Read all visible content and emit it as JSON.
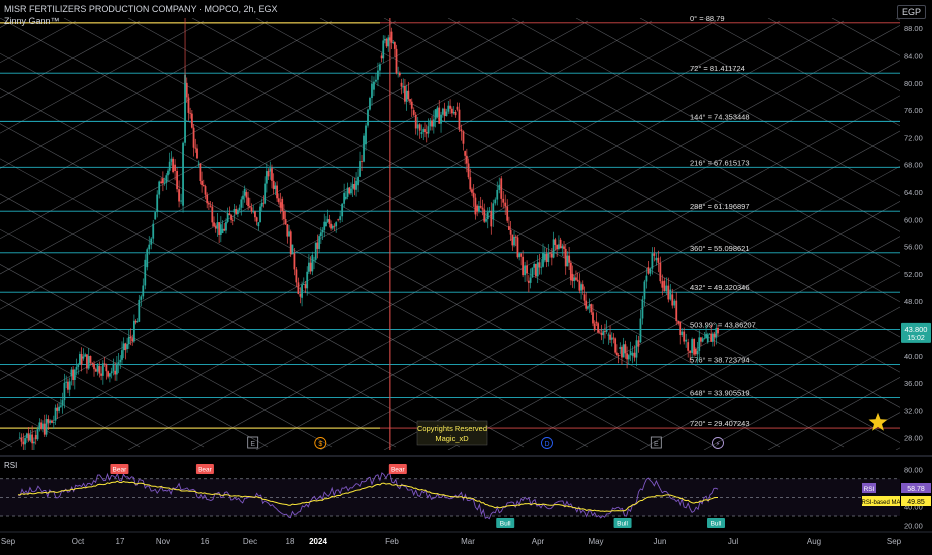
{
  "header": {
    "symbol_line": "MISR FERTILIZERS PRODUCTION COMPANY · MOPCO, 2h, EGX",
    "indicator_name": "Zinny Gann™",
    "currency": "EGP"
  },
  "watermark": {
    "line1": "Copyrights Reserved",
    "line2": "Magic_xD"
  },
  "colors": {
    "up": "#26a69a",
    "down": "#ef5350",
    "gann_level": "#26c6da",
    "gann_top": "#ffee58",
    "gann_red": "#ef5350",
    "diagonal": "#9598a1",
    "rsi": "#7e57c2",
    "rsi_ma": "#ffeb3b",
    "star": "#f5c518"
  },
  "chart_data": [
    {
      "type": "candlestick",
      "price_axis": {
        "ticks": [
          88,
          84,
          80,
          76,
          72,
          68,
          64,
          60,
          56,
          52,
          48,
          44,
          40,
          36,
          32,
          28
        ],
        "range": [
          26.2,
          89.5
        ]
      },
      "time_axis": {
        "labels": [
          "Sep",
          "Oct",
          "17",
          "Nov",
          "16",
          "Dec",
          "18",
          "2024",
          "Feb",
          "Mar",
          "Apr",
          "May",
          "Jun",
          "Jul",
          "Aug",
          "Sep"
        ]
      },
      "current_price": {
        "value": "43.800",
        "countdown": "15:02"
      },
      "gann_levels": [
        {
          "label": "0° = 88.79",
          "value": 88.79
        },
        {
          "label": "72° = 81.411724",
          "value": 81.411724
        },
        {
          "label": "144° = 74.353448",
          "value": 74.353448
        },
        {
          "label": "216° = 67.615173",
          "value": 67.615173
        },
        {
          "label": "288° = 61.196897",
          "value": 61.196897
        },
        {
          "label": "360° = 55.098621",
          "value": 55.098621
        },
        {
          "label": "432° = 49.320346",
          "value": 49.320346
        },
        {
          "label": "503.99° = 43.86207",
          "value": 43.86207
        },
        {
          "label": "576° = 38.723794",
          "value": 38.723794
        },
        {
          "label": "648° = 33.905519",
          "value": 33.905519
        },
        {
          "label": "720° = 29.407243",
          "value": 29.407243
        }
      ],
      "price_path": [
        [
          0,
          28.0
        ],
        [
          0.4,
          28.4
        ],
        [
          0.9,
          30.5
        ],
        [
          1.3,
          37
        ],
        [
          1.6,
          39.6
        ],
        [
          2.0,
          38.5
        ],
        [
          2.4,
          37.8
        ],
        [
          2.7,
          41
        ],
        [
          3.0,
          45
        ],
        [
          3.2,
          53
        ],
        [
          3.4,
          60
        ],
        [
          3.6,
          66
        ],
        [
          3.9,
          68
        ],
        [
          4.1,
          62
        ],
        [
          4.2,
          80
        ],
        [
          4.5,
          68
        ],
        [
          4.8,
          62
        ],
        [
          5.1,
          58
        ],
        [
          5.4,
          61
        ],
        [
          5.7,
          64
        ],
        [
          6.0,
          59
        ],
        [
          6.3,
          67
        ],
        [
          6.6,
          63
        ],
        [
          6.9,
          55
        ],
        [
          7.1,
          48.5
        ],
        [
          7.4,
          54
        ],
        [
          7.7,
          59
        ],
        [
          8.0,
          60
        ],
        [
          8.2,
          63
        ],
        [
          8.5,
          65
        ],
        [
          8.7,
          71
        ],
        [
          8.9,
          79
        ],
        [
          9.1,
          84
        ],
        [
          9.35,
          87.5
        ],
        [
          9.6,
          80
        ],
        [
          9.9,
          76
        ],
        [
          10.1,
          72.5
        ],
        [
          10.5,
          75
        ],
        [
          11.0,
          76.5
        ],
        [
          11.2,
          70
        ],
        [
          11.5,
          62
        ],
        [
          11.9,
          60
        ],
        [
          12.1,
          66
        ],
        [
          12.3,
          59
        ],
        [
          12.6,
          55
        ],
        [
          12.8,
          51
        ],
        [
          13.2,
          54
        ],
        [
          13.6,
          57
        ],
        [
          13.9,
          52
        ],
        [
          14.2,
          49
        ],
        [
          14.5,
          45
        ],
        [
          14.8,
          43
        ],
        [
          15.1,
          41
        ],
        [
          15.4,
          40
        ],
        [
          15.6,
          42
        ],
        [
          15.8,
          53
        ],
        [
          16.0,
          54
        ],
        [
          16.2,
          51
        ],
        [
          16.4,
          49
        ],
        [
          16.6,
          45
        ],
        [
          16.8,
          42
        ],
        [
          17.0,
          41
        ],
        [
          17.3,
          42
        ],
        [
          17.6,
          43.8
        ]
      ],
      "events": [
        {
          "kind": "earnings",
          "label": "E",
          "at": 5.9
        },
        {
          "kind": "dividend",
          "label": "$",
          "at": 7.6
        },
        {
          "kind": "dividend",
          "label": "D",
          "at": 13.3
        },
        {
          "kind": "earnings",
          "label": "E",
          "at": 16.05
        },
        {
          "kind": "split",
          "label": "⚡",
          "at": 17.6
        }
      ],
      "star_marker": {
        "price": 30.2
      }
    },
    {
      "type": "line",
      "name": "RSI",
      "axis": {
        "ticks": [
          80,
          60,
          40,
          20
        ],
        "range": [
          15,
          88
        ]
      },
      "bands": {
        "upper": 70,
        "middle": 50,
        "lower": 30
      },
      "series": [
        {
          "name": "RSI",
          "value": "58.78",
          "points": [
            [
              0,
              54
            ],
            [
              0.5,
              58
            ],
            [
              1.0,
              52
            ],
            [
              1.5,
              62
            ],
            [
              2.0,
              70
            ],
            [
              2.5,
              73
            ],
            [
              3.0,
              66
            ],
            [
              3.4,
              60
            ],
            [
              3.8,
              55
            ],
            [
              4.1,
              62
            ],
            [
              4.4,
              55
            ],
            [
              4.8,
              49
            ],
            [
              5.2,
              53
            ],
            [
              5.6,
              46
            ],
            [
              6.0,
              50
            ],
            [
              6.4,
              44
            ],
            [
              6.8,
              31
            ],
            [
              7.2,
              42
            ],
            [
              7.6,
              51
            ],
            [
              8.0,
              57
            ],
            [
              8.4,
              60
            ],
            [
              8.8,
              67
            ],
            [
              9.3,
              74
            ],
            [
              9.7,
              60
            ],
            [
              10.1,
              55
            ],
            [
              10.6,
              50
            ],
            [
              11.0,
              54
            ],
            [
              11.4,
              47
            ],
            [
              11.8,
              30
            ],
            [
              12.3,
              42
            ],
            [
              12.8,
              47
            ],
            [
              13.2,
              40
            ],
            [
              13.7,
              45
            ],
            [
              14.2,
              35
            ],
            [
              14.6,
              30
            ],
            [
              15.0,
              36
            ],
            [
              15.4,
              33
            ],
            [
              15.8,
              72
            ],
            [
              16.2,
              58
            ],
            [
              16.6,
              47
            ],
            [
              17.0,
              36
            ],
            [
              17.3,
              48
            ],
            [
              17.6,
              58.78
            ]
          ]
        },
        {
          "name": "RSI-based MA",
          "value": "49.85",
          "points": [
            [
              0,
              53
            ],
            [
              1.0,
              56
            ],
            [
              2.0,
              63
            ],
            [
              2.5,
              67
            ],
            [
              3.2,
              64
            ],
            [
              4.0,
              58
            ],
            [
              5.0,
              53
            ],
            [
              6.0,
              50
            ],
            [
              6.8,
              42
            ],
            [
              7.6,
              47
            ],
            [
              8.4,
              56
            ],
            [
              9.2,
              65
            ],
            [
              9.8,
              62
            ],
            [
              10.6,
              53
            ],
            [
              11.4,
              49
            ],
            [
              12.0,
              39
            ],
            [
              12.8,
              43
            ],
            [
              13.6,
              42
            ],
            [
              14.4,
              36
            ],
            [
              15.2,
              35
            ],
            [
              15.8,
              50
            ],
            [
              16.4,
              53
            ],
            [
              17.0,
              44
            ],
            [
              17.6,
              49.85
            ]
          ]
        }
      ],
      "signals": [
        {
          "label": "Bear",
          "at": 2.55
        },
        {
          "label": "Bear",
          "at": 4.7
        },
        {
          "label": "Bear",
          "at": 9.55
        },
        {
          "label": "Bull",
          "at": 12.25
        },
        {
          "label": "Bull",
          "at": 15.2
        },
        {
          "label": "Bull",
          "at": 17.55
        }
      ]
    }
  ]
}
